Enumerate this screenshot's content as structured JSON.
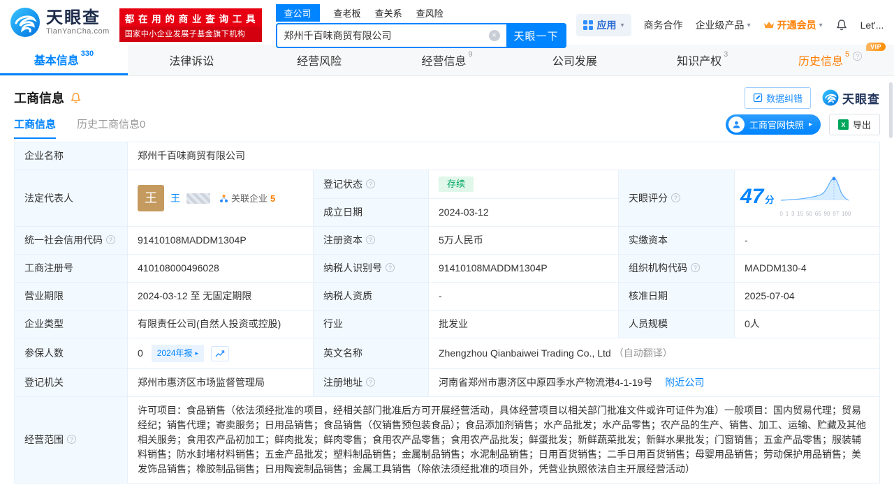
{
  "icons": {
    "caret": "▾",
    "arrow_right": "▸",
    "clear": "×",
    "help": "?"
  },
  "brand": {
    "name": "天眼查",
    "domain": "TianYanCha.com",
    "slogan1": "都 在 用 的 商 业 查 询 工 具",
    "slogan2": "国家中小企业发展子基金旗下机构"
  },
  "search": {
    "tabs": [
      {
        "label": "查公司"
      },
      {
        "label": "查老板"
      },
      {
        "label": "查关系"
      },
      {
        "label": "查风险"
      }
    ],
    "value": "郑州千百味商贸有限公司",
    "button": "天眼一下"
  },
  "topnav": {
    "apps": "应用",
    "cooperation": "商务合作",
    "enterprise": "企业级产品",
    "vip": "开通会员",
    "user": "Let'..."
  },
  "tabs": [
    {
      "label": "基本信息",
      "badge": "330"
    },
    {
      "label": "法律诉讼",
      "badge": ""
    },
    {
      "label": "经营风险",
      "badge": ""
    },
    {
      "label": "经营信息",
      "badge": "9"
    },
    {
      "label": "公司发展",
      "badge": ""
    },
    {
      "label": "知识产权",
      "badge": "3"
    },
    {
      "label": "历史信息",
      "badge": "5",
      "vip": "VIP"
    }
  ],
  "section": {
    "title": "工商信息",
    "correction": "数据纠错",
    "watermark_brand": "天眼查",
    "subtab_active": "工商信息",
    "subtab_history": "历史工商信息0",
    "snapshot": "工商官网快照",
    "export": "导出"
  },
  "info": {
    "name_label": "企业名称",
    "name": "郑州千百味商贸有限公司",
    "legal_label": "法定代表人",
    "legal_avatar": "王",
    "legal_name": "王",
    "related": "关联企业",
    "related_count": "5",
    "status_label": "登记状态",
    "status": "存续",
    "established_label": "成立日期",
    "established": "2024-03-12",
    "score_label": "天眼评分",
    "score": "47",
    "score_unit": "分",
    "credit_label": "统一社会信用代码",
    "credit": "91410108MADDM1304P",
    "capital_label": "注册资本",
    "capital": "5万人民币",
    "paid_label": "实缴资本",
    "paid": "-",
    "regno_label": "工商注册号",
    "regno": "410108000496028",
    "taxid_label": "纳税人识别号",
    "taxid": "91410108MADDM1304P",
    "orgcode_label": "组织机构代码",
    "orgcode": "MADDM130-4",
    "term_label": "营业期限",
    "term": "2024-03-12 至 无固定期限",
    "taxquality_label": "纳税人资质",
    "taxquality": "-",
    "approval_label": "核准日期",
    "approval": "2025-07-04",
    "type_label": "企业类型",
    "type": "有限责任公司(自然人投资或控股)",
    "industry_label": "行业",
    "industry": "批发业",
    "staff_label": "人员规模",
    "staff": "0人",
    "insured_label": "参保人数",
    "insured": "0",
    "annual": "2024年报",
    "english_label": "英文名称",
    "english": "Zhengzhou Qianbaiwei Trading Co., Ltd",
    "english_note": "（自动翻译）",
    "authority_label": "登记机关",
    "authority": "郑州市惠济区市场监督管理局",
    "address_label": "注册地址",
    "address": "河南省郑州市惠济区中原四季水产物流港4-1-19号",
    "nearby": "附近公司",
    "scope_label": "经营范围",
    "scope": "许可项目：食品销售（依法须经批准的项目，经相关部门批准后方可开展经营活动，具体经营项目以相关部门批准文件或许可证件为准）一般项目：国内贸易代理；贸易经纪；销售代理；寄卖服务；日用品销售；食品销售（仅销售预包装食品）；食品添加剂销售；水产品批发；水产品零售；农产品的生产、销售、加工、运输、贮藏及其他相关服务；食用农产品初加工；鲜肉批发；鲜肉零售；食用农产品零售；食用农产品批发；鲜蛋批发；新鲜蔬菜批发；新鲜水果批发；门窗销售；五金产品零售；服装辅料销售；防水封堵材料销售；五金产品批发；塑料制品销售；金属制品销售；水泥制品销售；日用百货销售；二手日用百货销售；母婴用品销售；劳动保护用品销售；美发饰品销售；橡胶制品销售；日用陶瓷制品销售；金属工具销售（除依法须经批准的项目外，凭营业执照依法自主开展经营活动）"
  },
  "score_chart": {
    "ticks": [
      "0",
      "1",
      "3",
      "15",
      "50",
      "65",
      "90",
      "97",
      "100"
    ]
  },
  "colors": {
    "primary": "#0084ff",
    "red": "#e60012",
    "orange": "#ff7d00",
    "green": "#00a862"
  }
}
